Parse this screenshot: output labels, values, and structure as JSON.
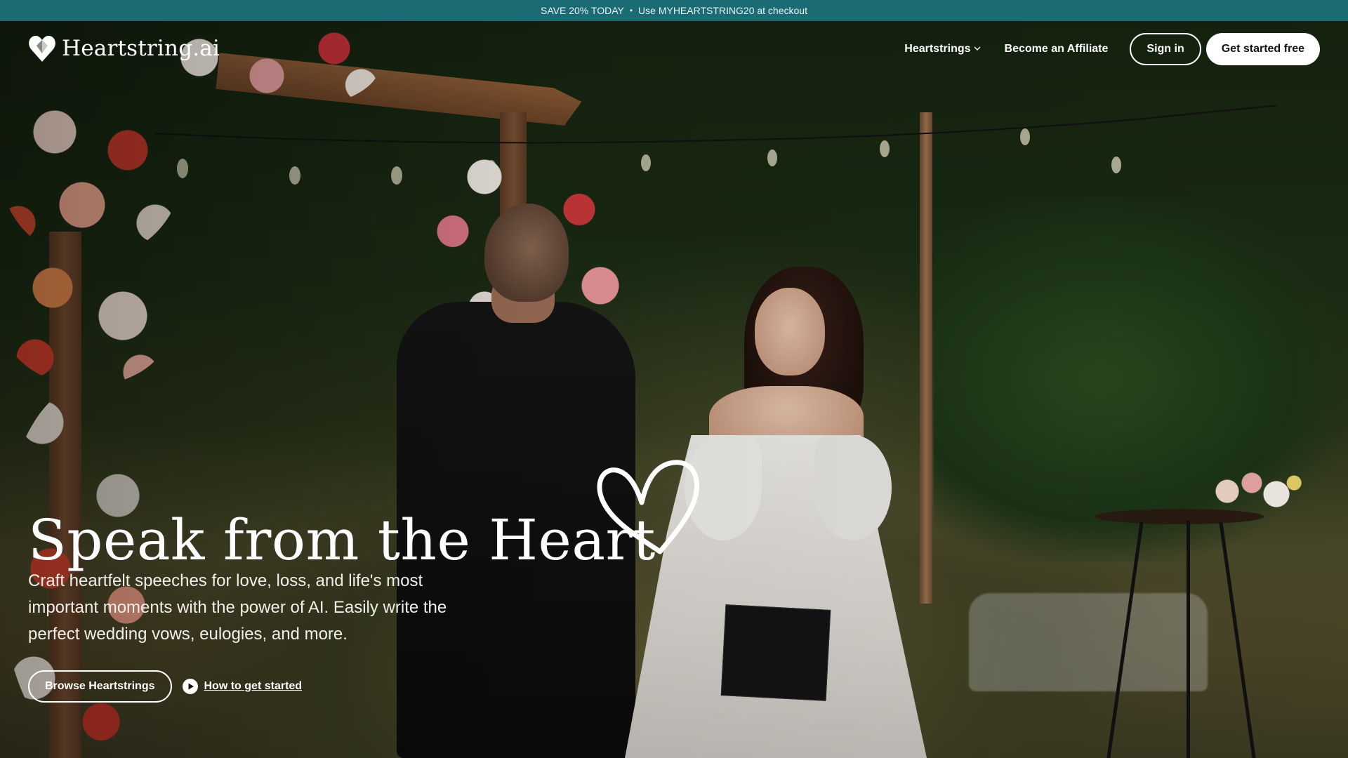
{
  "promo": {
    "left": "SAVE 20% TODAY",
    "separator": "•",
    "right": "Use MYHEARTSTRING20 at checkout"
  },
  "nav": {
    "logo_text": "Heartstring.ai",
    "logo_icon": "heart-logo-icon",
    "links": {
      "heartstrings": "Heartstrings",
      "affiliate": "Become an Affiliate"
    },
    "sign_in": "Sign in",
    "get_started": "Get started free"
  },
  "hero": {
    "title": "Speak from the Heart",
    "subtitle": "Craft heartfelt speeches for love, loss, and life's most important moments with the power of AI. Easily write the perfect wedding vows, eulogies, and more.",
    "browse_button": "Browse Heartstrings",
    "how_link": "How to get started",
    "how_icon": "play-circle-icon"
  },
  "colors": {
    "promo_bg": "#1a6b73",
    "text_light": "#ffffff",
    "button_dark_text": "#111111"
  }
}
